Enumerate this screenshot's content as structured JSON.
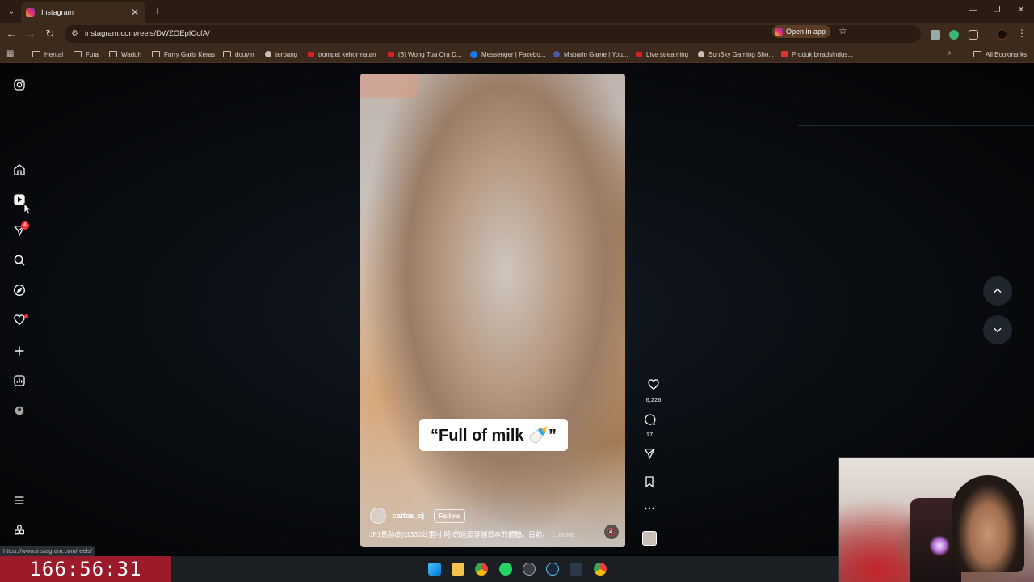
{
  "browser": {
    "tab_title": "Instagram",
    "tab_close": "✕",
    "new_tab": "+",
    "url": "instagram.com/reels/DWZOEpICcfA/",
    "open_in_app": "Open in app",
    "window_controls": [
      "—",
      "❐",
      "✕"
    ]
  },
  "bookmarks": [
    {
      "label": "Hentai",
      "icon": "folder-icon"
    },
    {
      "label": "Futa",
      "icon": "folder-icon"
    },
    {
      "label": "Waduh",
      "icon": "folder-icon"
    },
    {
      "label": "Furry Garis Keras",
      "icon": "folder-icon"
    },
    {
      "label": "douyin",
      "icon": "folder-icon"
    },
    {
      "label": "terbang",
      "icon": "globe-icon"
    },
    {
      "label": "trompet kehormatan",
      "icon": "youtube-icon"
    },
    {
      "label": "(3) Wong Tua Ora D...",
      "icon": "youtube-icon"
    },
    {
      "label": "Messenger | Facebo...",
      "icon": "facebook-icon"
    },
    {
      "label": "Mabarin Game | You...",
      "icon": "globe-icon"
    },
    {
      "label": "Live streaming",
      "icon": "youtube-icon"
    },
    {
      "label": "SunSky Gaming Sho...",
      "icon": "globe-icon"
    },
    {
      "label": "Produk brradsindus...",
      "icon": "shop-icon"
    }
  ],
  "all_bookmarks": "All Bookmarks",
  "sidebar": {
    "notifications_badge": "4"
  },
  "reel": {
    "caption_overlay": "“Full of milk 🍼”",
    "owner": "cattos_cj",
    "follow": "Follow",
    "description": "JP1馬赫(的)1330公里/小時)的速度穿越日本的體驗。目前、",
    "more": "... more",
    "likes": "6,226",
    "comments": "17"
  },
  "status_bar_url": "https://www.instagram.com/reels/",
  "stream_timer": "166:56:31",
  "colors": {
    "accent_badge": "#ff3040",
    "timer_bg": "#9b1b2a",
    "browser_frame": "#3c2a1c"
  }
}
